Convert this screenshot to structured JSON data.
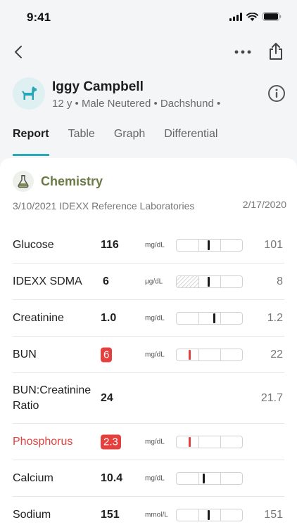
{
  "status": {
    "time": "9:41"
  },
  "patient": {
    "name": "Iggy Campbell",
    "meta": "12 y • Male Neutered • Dachshund •"
  },
  "tabs": [
    {
      "label": "Report",
      "active": true
    },
    {
      "label": "Table",
      "active": false
    },
    {
      "label": "Graph",
      "active": false
    },
    {
      "label": "Differential",
      "active": false
    }
  ],
  "section": {
    "title": "Chemistry",
    "source": "3/10/2021 IDEXX Reference Laboratories",
    "previous_date": "2/17/2020"
  },
  "results": [
    {
      "name": "Glucose",
      "value": "116",
      "unit": "mg/dL",
      "previous": "101",
      "level": 0.49,
      "status": "normal",
      "hatched": false
    },
    {
      "name": "IDEXX SDMA",
      "value": "6",
      "unit": "μg/dL",
      "previous": "8",
      "level": 0.49,
      "status": "normal",
      "hatched": true
    },
    {
      "name": "Creatinine",
      "value": "1.0",
      "unit": "mg/dL",
      "previous": "1.2",
      "level": 0.57,
      "status": "normal",
      "hatched": false
    },
    {
      "name": "BUN",
      "value": "6",
      "unit": "mg/dL",
      "previous": "22",
      "level": 0.2,
      "status": "low",
      "hatched": false
    },
    {
      "name": "BUN:Creatinine Ratio",
      "value": "24",
      "unit": "",
      "previous": "21.7",
      "level": null,
      "status": "normal",
      "hatched": false
    },
    {
      "name": "Phosphorus",
      "value": "2.3",
      "unit": "mg/dL",
      "previous": "",
      "level": 0.2,
      "status": "low",
      "hatched": false
    },
    {
      "name": "Calcium",
      "value": "10.4",
      "unit": "mg/dL",
      "previous": "",
      "level": 0.41,
      "status": "normal",
      "hatched": false
    },
    {
      "name": "Sodium",
      "value": "151",
      "unit": "mmol/L",
      "previous": "151",
      "level": 0.49,
      "status": "normal",
      "hatched": false
    }
  ],
  "colors": {
    "accent": "#28a9b8",
    "abnormal": "#e4403d",
    "section": "#6b7a44"
  }
}
